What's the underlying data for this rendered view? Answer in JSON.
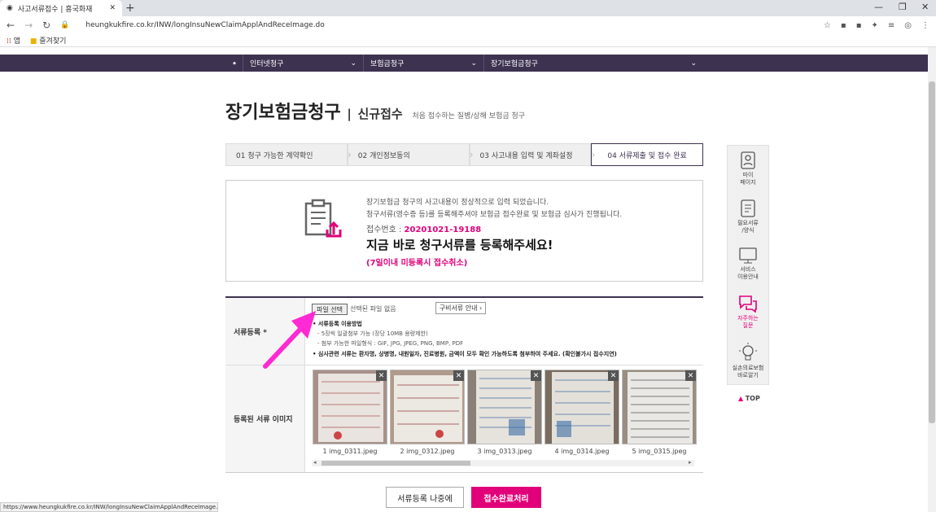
{
  "browser": {
    "tab_title": "사고서류접수 | 흥국화재",
    "tab_close": "✕",
    "new_tab": "+",
    "url": "heungkukfire.co.kr/INW/longInsuNewClaimApplAndReceImage.do",
    "bookmarks": [
      {
        "label": "앱",
        "icon": "apps-icon"
      },
      {
        "label": "즐겨찾기",
        "icon": "folder-icon"
      }
    ],
    "status_url": "https://www.heungkukfire.co.kr/INW/longInsuNewClaimApplAndReceImage.do#"
  },
  "gnb": {
    "home_icon": "home-icon",
    "items": [
      {
        "label": "인터넷청구"
      },
      {
        "label": "보험금청구"
      },
      {
        "label": "장기보험금청구"
      }
    ]
  },
  "page": {
    "title": "장기보험금청구",
    "separator": "|",
    "subtitle": "신규접수",
    "description": "처음 접수하는 질병/상해 보험금 청구"
  },
  "steps": [
    {
      "label": "01 청구 가능한 계약확인",
      "active": false
    },
    {
      "label": "02 개인정보동의",
      "active": false
    },
    {
      "label": "03 사고내용 입력 및 계좌설정",
      "active": false
    },
    {
      "label": "04 서류제출 및 접수 완료",
      "active": true
    }
  ],
  "info": {
    "line1": "장기보험금 청구의 사고내용이 정상적으로 입력 되었습니다.",
    "line2": "청구서류(영수증 등)를 등록해주셔야 보험금 접수완료 및 보험금 심사가 진행됩니다.",
    "receipt_label": "접수번호 :",
    "receipt_no": "20201021-19188",
    "headline": "지금 바로 청구서류를 등록해주세요!",
    "warning": "(7일이내 미등록시 접수취소)"
  },
  "form": {
    "doc_label": "서류등록 *",
    "file_button": "파일 선택",
    "no_file": "선택된 파일 없음",
    "guide_button": "구비서류 안내 ›",
    "usage_title": "• 서류등록 이용방법",
    "usage_1": "- 5장씩 일괄첨부 가능 (장당 10MB 용량제한)",
    "usage_2": "- 첨부 가능한 파일형식 : GIF, JPG, JPEG, PNG, BMP, PDF",
    "usage_3": "• 심사관련 서류는 환자명, 상병명, 내원일자, 진료병원, 금액이 모두 확인 가능하도록 첨부하여 주세요. (확인불가시 접수지연)",
    "images_label": "등록된 서류 이미지",
    "images": [
      {
        "caption": "1 img_0311.jpeg",
        "remove": "✕"
      },
      {
        "caption": "2 img_0312.jpeg",
        "remove": "✕"
      },
      {
        "caption": "3 img_0313.jpeg",
        "remove": "✕"
      },
      {
        "caption": "4 img_0314.jpeg",
        "remove": "✕"
      },
      {
        "caption": "5 img_0315.jpeg",
        "remove": "✕"
      }
    ]
  },
  "buttons": {
    "later": "서류등록 나중에",
    "complete": "접수완료처리"
  },
  "sidebar": [
    {
      "label1": "마이",
      "label2": "페이지",
      "icon": "person-icon"
    },
    {
      "label1": "필요서류",
      "label2": "/양식",
      "icon": "document-icon"
    },
    {
      "label1": "서비스",
      "label2": "이용안내",
      "icon": "monitor-icon"
    },
    {
      "label1": "자주하는",
      "label2": "질문",
      "icon": "chat-icon"
    },
    {
      "label1": "실손의료보험",
      "label2": "바로알기",
      "icon": "bulb-icon"
    }
  ],
  "top_link": "TOP",
  "colors": {
    "brand_purple": "#3d3250",
    "accent_pink": "#e2007a"
  }
}
